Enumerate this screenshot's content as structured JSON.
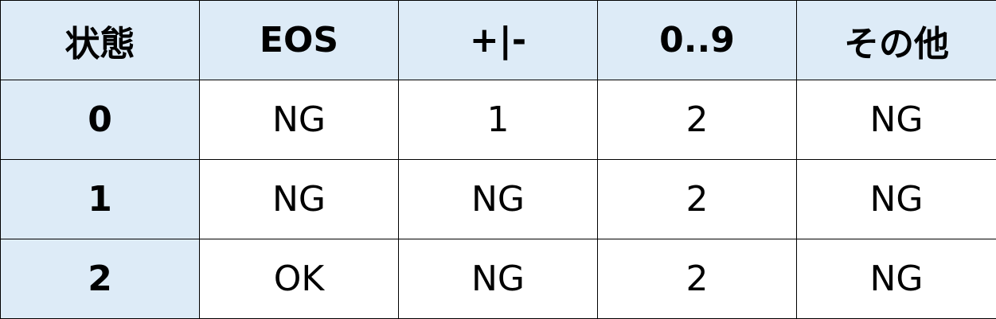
{
  "table": {
    "columns": [
      "状態",
      "EOS",
      "+|-",
      "0..9",
      "その他"
    ],
    "rows": [
      {
        "state": "0",
        "cells": [
          "NG",
          "1",
          "2",
          "NG"
        ]
      },
      {
        "state": "1",
        "cells": [
          "NG",
          "NG",
          "2",
          "NG"
        ]
      },
      {
        "state": "2",
        "cells": [
          "OK",
          "NG",
          "2",
          "NG"
        ]
      }
    ]
  },
  "colors": {
    "header_background": "#ddebf7",
    "border": "#000000",
    "text": "#000000"
  }
}
